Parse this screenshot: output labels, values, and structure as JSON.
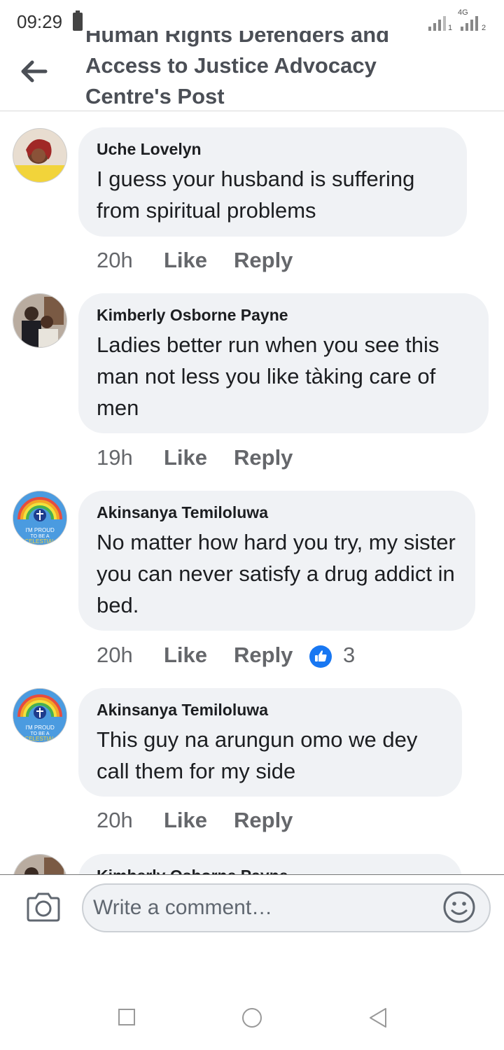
{
  "status_bar": {
    "time": "09:29",
    "sim1_label": "1",
    "sim2_label": "2",
    "network_label": "4G"
  },
  "header": {
    "title": "Human Rights Defenders and Access to Justice Advocacy Centre's Post",
    "back_icon": "arrow-left-icon"
  },
  "comments": [
    {
      "author": "Uche Lovelyn",
      "text": "I guess your husband is suffering from spiritual problems",
      "time": "20h",
      "like_label": "Like",
      "reply_label": "Reply"
    },
    {
      "author": "Kimberly Osborne Payne",
      "text": "Ladies better run when you see this man not less you like tàking care of men",
      "time": "19h",
      "like_label": "Like",
      "reply_label": "Reply"
    },
    {
      "author": "Akinsanya Temiloluwa",
      "text": "No matter how hard you try, my sister you can never satisfy a drug addict in bed.",
      "time": "20h",
      "like_label": "Like",
      "reply_label": "Reply",
      "reaction_count": "3",
      "reaction_icon": "thumbs-up-icon",
      "avatar_text": "I'M PROUD TO BE A CELESTIAL"
    },
    {
      "author": "Akinsanya Temiloluwa",
      "text": "This guy na arungun omo we dey call them for my side",
      "time": "20h",
      "like_label": "Like",
      "reply_label": "Reply",
      "avatar_text": "I'M PROUD TO BE A CELESTIAL"
    },
    {
      "author": "Kimberly Osborne Payne"
    }
  ],
  "composer": {
    "placeholder": "Write a comment…",
    "camera_icon": "camera-icon",
    "emoji_icon": "smiley-icon"
  },
  "colors": {
    "bubble": "#f0f2f5",
    "header_text": "#4b4f56",
    "meta_text": "#65676b",
    "reaction_blue": "#1877f2"
  }
}
